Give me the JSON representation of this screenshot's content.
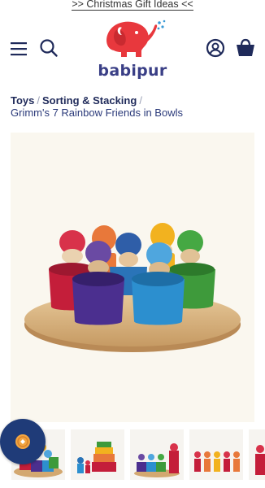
{
  "announcement": {
    "text": ">> Christmas Gift Ideas <<"
  },
  "header": {
    "logo_text": "babipur",
    "icons": [
      "menu-icon",
      "search-icon",
      "account-icon",
      "cart-icon"
    ]
  },
  "breadcrumb": {
    "items": [
      {
        "label": "Toys"
      },
      {
        "label": "Sorting & Stacking"
      }
    ],
    "separator": "/",
    "current": "Grimm's 7 Rainbow Friends in Bowls"
  },
  "product_images": {
    "thumbnail_count": 5,
    "selected_index": 0
  },
  "colors": {
    "brand_navy": "#1f2a5a",
    "logo_red": "#e8383d",
    "logo_blue": "#3a9ad6",
    "reward_button": "#1f3b78"
  }
}
